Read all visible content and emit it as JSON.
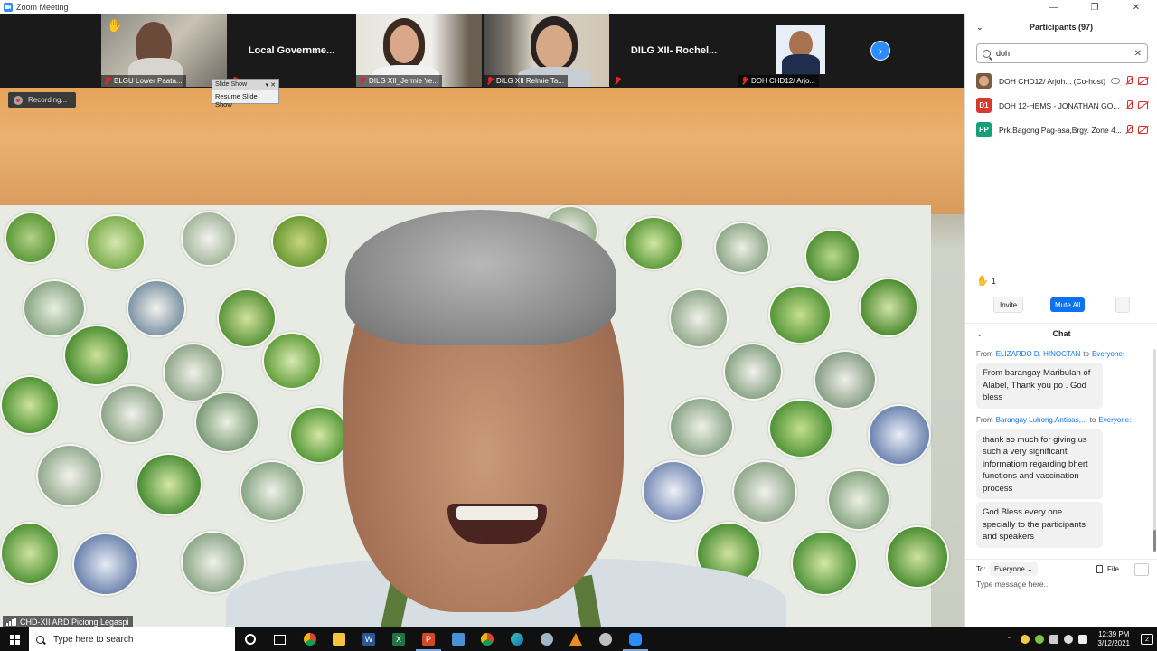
{
  "window": {
    "title": "Zoom Meeting",
    "controls": [
      "—",
      "❐",
      "✕"
    ]
  },
  "thumbnails": [
    {
      "name": "BLGU Lower Paata...",
      "type": "video",
      "hand_raised": true
    },
    {
      "name": "Local  Governme...",
      "type": "name"
    },
    {
      "name": "DILG XII_Jermie Ye...",
      "type": "video"
    },
    {
      "name": "DILG XII Relmie Ta...",
      "type": "video"
    },
    {
      "name": "DILG XII- Rochel...",
      "type": "name"
    },
    {
      "name": "DOH CHD12/ Arjo...",
      "type": "video"
    }
  ],
  "recording": {
    "label": "Recording..."
  },
  "slideshow": {
    "title": "Slide Show",
    "item": "Resume Slide Show"
  },
  "main_speaker": {
    "label": "CHD-XII ARD Piciong Legaspi"
  },
  "participants_panel": {
    "title": "Participants (97)",
    "search_value": "doh",
    "items": [
      {
        "name": "DOH CHD12/ Arjoh... (Co-host)",
        "avatar": "",
        "avatar_color": "#7a5a40"
      },
      {
        "name": "DOH 12-HEMS - JONATHAN GO...",
        "avatar": "D1",
        "avatar_color": "#d63a2f"
      },
      {
        "name": "Prk.Bagong Pag-asa,Brgy. Zone 4...",
        "avatar": "PP",
        "avatar_color": "#15a07a"
      }
    ],
    "hand_count": "1",
    "invite_label": "Invite",
    "mute_all_label": "Mute All",
    "more_label": "..."
  },
  "chat": {
    "title": "Chat",
    "messages": [
      {
        "from_prefix": "From",
        "sender": "ELIZARDO D. HINOCTAN",
        "to_word": "to",
        "target": "Everyone:",
        "text": "From barangay Maribulan of Alabel, Thank you po . God bless"
      },
      {
        "from_prefix": "From",
        "sender": "Barangay Luhong,Antipas,...",
        "to_word": "to",
        "target": "Everyone:",
        "text": "thank so much for giving us such a very significant informatiom regarding bhert functions and vaccination process"
      },
      {
        "from_prefix": "",
        "sender": "",
        "to_word": "",
        "target": "",
        "text": "God Bless every one specially to the participants and speakers"
      }
    ],
    "to_label": "To:",
    "to_value": "Everyone",
    "file_label": "File",
    "more_label": "...",
    "input_placeholder": "Type message here..."
  },
  "taskbar": {
    "search_placeholder": "Type here to search",
    "time": "12:39 PM",
    "date": "3/12/2021",
    "notifications": "2",
    "apps": [
      "task-view-icon",
      "chrome-icon",
      "file-explorer-icon",
      "word-icon",
      "excel-icon",
      "powerpoint-icon",
      "store-icon",
      "chrome-icon",
      "edge-icon",
      "settings-icon",
      "vlc-icon",
      "unknown-app-icon",
      "zoom-icon"
    ]
  },
  "colors": {
    "accent_blue": "#0e72ed",
    "zoom_blue": "#2d8cff",
    "mute_red": "#e02828"
  }
}
